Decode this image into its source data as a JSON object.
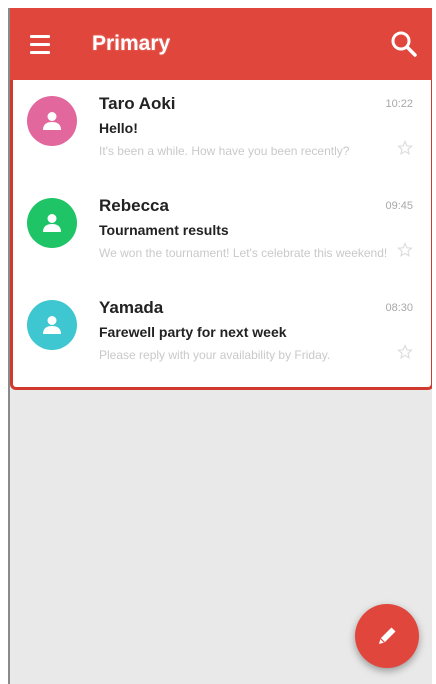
{
  "app_bar": {
    "title": "Primary",
    "color": "#e0463b"
  },
  "icons": {
    "menu": "hamburger-menu-icon",
    "search": "search-icon",
    "compose": "pencil-icon",
    "avatar": "person-icon",
    "star": "star-outline-icon"
  },
  "messages": [
    {
      "sender": "Taro Aoki",
      "subject": "Hello!",
      "snippet": "It's been a while. How have you been recently?",
      "time": "10:22",
      "avatar_color": "#e2679d"
    },
    {
      "sender": "Rebecca",
      "subject": "Tournament results",
      "snippet": "We won the tournament! Let's celebrate this weekend!",
      "time": "09:45",
      "avatar_color": "#1ec466"
    },
    {
      "sender": "Yamada",
      "subject": "Farewell party for next week",
      "snippet": "Please reply with your availability by Friday.",
      "time": "08:30",
      "avatar_color": "#3fc7d1"
    }
  ]
}
